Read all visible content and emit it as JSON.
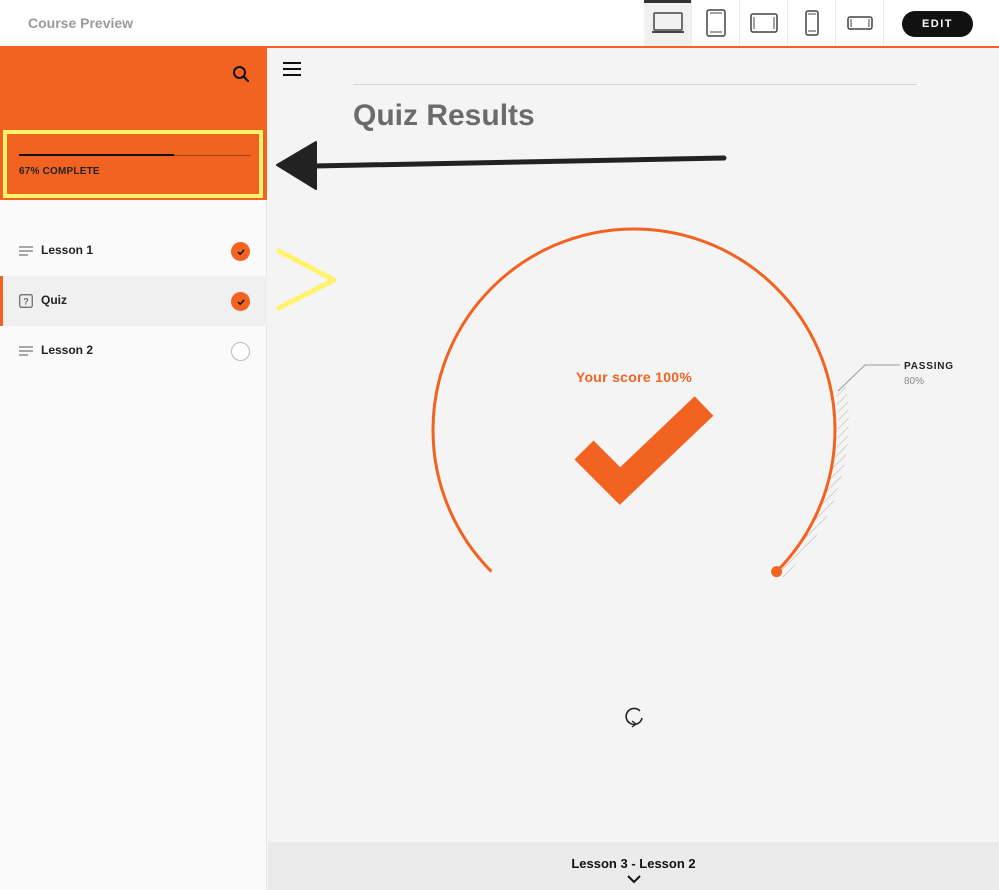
{
  "app": {
    "title": "Course Preview"
  },
  "toolbar": {
    "devices": [
      {
        "name": "laptop",
        "active": true
      },
      {
        "name": "tablet-portrait",
        "active": false
      },
      {
        "name": "tablet-landscape",
        "active": false
      },
      {
        "name": "phone-portrait",
        "active": false
      },
      {
        "name": "phone-landscape",
        "active": false
      }
    ],
    "edit_label": "EDIT"
  },
  "sidebar": {
    "progress": {
      "label": "67% COMPLETE",
      "percent": 67
    },
    "lessons": [
      {
        "label": "Lesson 1",
        "icon": "lines-icon",
        "status": "complete",
        "active": false
      },
      {
        "label": "Quiz",
        "icon": "quiz-icon",
        "status": "complete",
        "active": true
      },
      {
        "label": "Lesson 2",
        "icon": "lines-icon",
        "status": "incomplete",
        "active": false
      }
    ]
  },
  "main": {
    "title": "Quiz Results",
    "score_text": "Your score 100%",
    "passing_label": "PASSING",
    "passing_value": "80%",
    "next_lesson": "Lesson 3 - Lesson 2"
  },
  "colors": {
    "accent": "#f26322",
    "highlight": "#fff36b",
    "dark": "#111111"
  }
}
